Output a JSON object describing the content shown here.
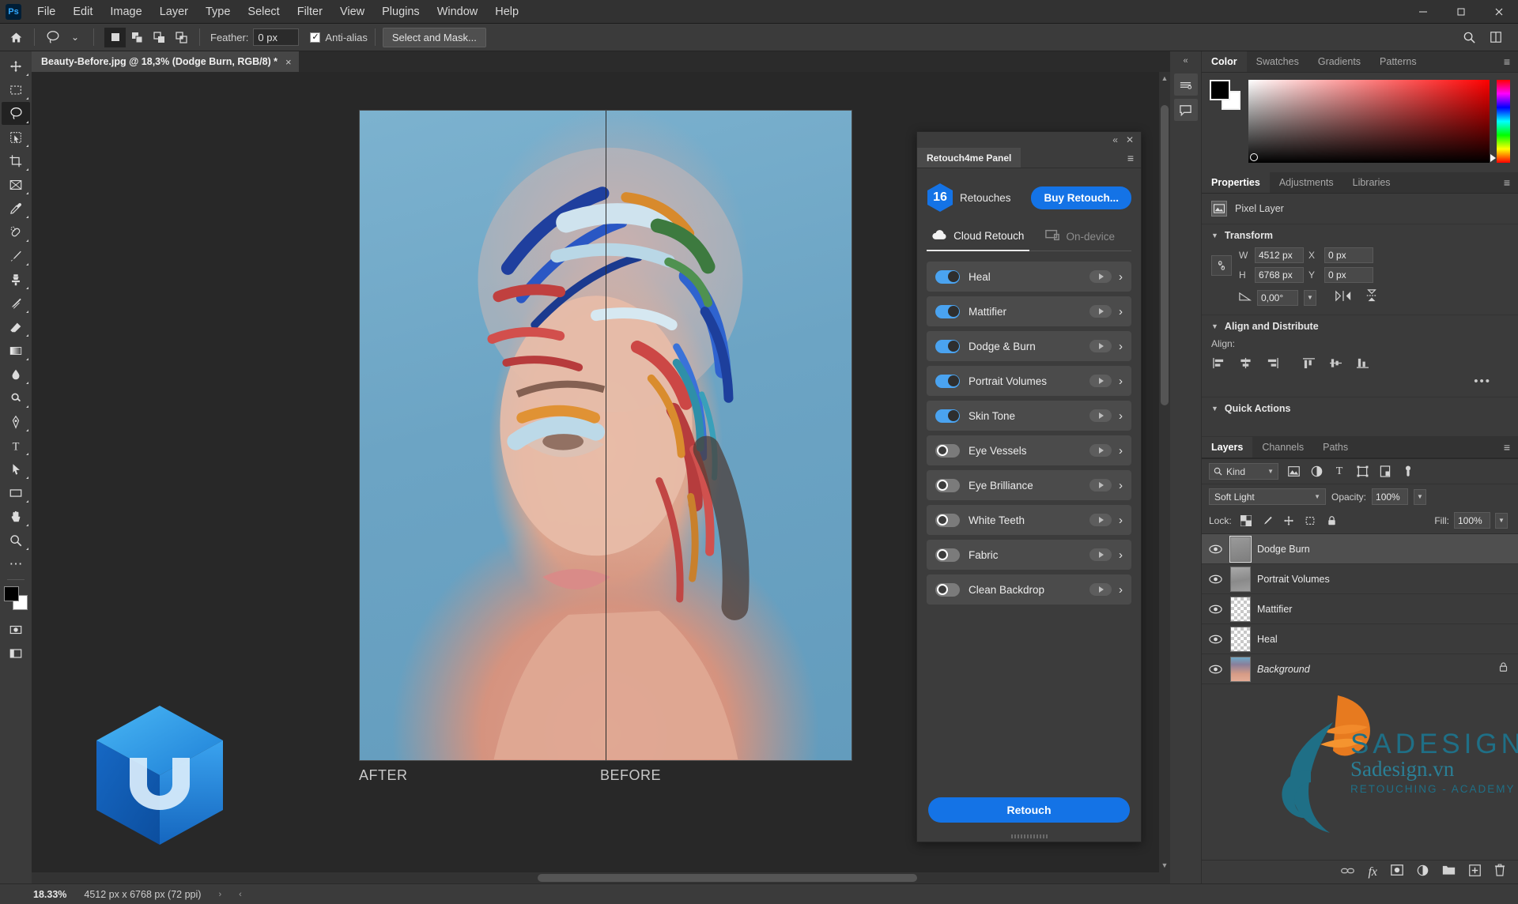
{
  "app": {
    "logo_text": "Ps",
    "menus": [
      "File",
      "Edit",
      "Image",
      "Layer",
      "Type",
      "Select",
      "Filter",
      "View",
      "Plugins",
      "Window",
      "Help"
    ],
    "window_buttons": {
      "minimize": "─",
      "maximize": "❐",
      "close": "✕"
    }
  },
  "options_bar": {
    "home_icon": "home-icon",
    "tool_icon": "lasso-icon",
    "tool_caret": "⌄",
    "selection_modes": [
      "new-selection",
      "add-to-selection",
      "subtract-from-selection",
      "intersect-selection"
    ],
    "feather_label": "Feather:",
    "feather_value": "0 px",
    "antialias_label": "Anti-alias",
    "antialias_checked": true,
    "select_and_mask_label": "Select and Mask...",
    "search_icon": "search-icon",
    "arrange_icon": "arrange-documents-icon"
  },
  "document": {
    "tab_title": "Beauty-Before.jpg @ 18,3% (Dodge Burn, RGB/8) *",
    "tab_close": "×",
    "label_after": "AFTER",
    "label_before": "BEFORE"
  },
  "toolbar": {
    "tools": [
      {
        "name": "move-tool",
        "glyph": "✥",
        "active": false
      },
      {
        "name": "rectangular-marquee-tool",
        "glyph": "⬚",
        "active": false
      },
      {
        "name": "lasso-tool",
        "glyph": "⥁",
        "active": true
      },
      {
        "name": "object-selection-tool",
        "glyph": "⬚",
        "active": false
      },
      {
        "name": "crop-tool",
        "glyph": "⌗",
        "active": false
      },
      {
        "name": "frame-tool",
        "glyph": "⌧",
        "active": false
      },
      {
        "name": "eyedropper-tool",
        "glyph": "✒",
        "active": false
      },
      {
        "name": "spot-healing-brush-tool",
        "glyph": "✘",
        "active": false
      },
      {
        "name": "brush-tool",
        "glyph": "✎",
        "active": false
      },
      {
        "name": "clone-stamp-tool",
        "glyph": "⚑",
        "active": false
      },
      {
        "name": "history-brush-tool",
        "glyph": "✐",
        "active": false
      },
      {
        "name": "eraser-tool",
        "glyph": "◱",
        "active": false
      },
      {
        "name": "gradient-tool",
        "glyph": "■",
        "active": false
      },
      {
        "name": "blur-tool",
        "glyph": "●",
        "active": false
      },
      {
        "name": "dodge-tool",
        "glyph": "⚲",
        "active": false
      },
      {
        "name": "pen-tool",
        "glyph": "✒",
        "active": false
      },
      {
        "name": "type-tool",
        "glyph": "T",
        "active": false
      },
      {
        "name": "path-selection-tool",
        "glyph": "➤",
        "active": false
      },
      {
        "name": "rectangle-tool",
        "glyph": "▭",
        "active": false
      },
      {
        "name": "hand-tool",
        "glyph": "✋",
        "active": false
      },
      {
        "name": "zoom-tool",
        "glyph": "⌕",
        "active": false
      },
      {
        "name": "more-tools",
        "glyph": "⋯",
        "active": false
      },
      {
        "name": "edit-toolbar",
        "glyph": "□",
        "active": false
      }
    ],
    "quickmask_name": "quick-mask-mode",
    "screenmode_name": "screen-mode"
  },
  "retouch_panel": {
    "collapse_glyph": "«",
    "close_glyph": "✕",
    "tab_label": "Retouch4me Panel",
    "menu_glyph": "≡",
    "credits_count": "16",
    "credits_label": "Retouches",
    "buy_label": "Buy Retouch...",
    "modes": [
      {
        "label": "Cloud Retouch",
        "icon": "cloud-icon",
        "active": true
      },
      {
        "label": "On-device",
        "icon": "monitor-icon",
        "active": false
      }
    ],
    "tools": [
      {
        "label": "Heal",
        "enabled": true
      },
      {
        "label": "Mattifier",
        "enabled": true
      },
      {
        "label": "Dodge & Burn",
        "enabled": true
      },
      {
        "label": "Portrait Volumes",
        "enabled": true
      },
      {
        "label": "Skin Tone",
        "enabled": true
      },
      {
        "label": "Eye Vessels",
        "enabled": false
      },
      {
        "label": "Eye Brilliance",
        "enabled": false
      },
      {
        "label": "White Teeth",
        "enabled": false
      },
      {
        "label": "Fabric",
        "enabled": false
      },
      {
        "label": "Clean Backdrop",
        "enabled": false
      }
    ],
    "retouch_button": "Retouch",
    "accent_color": "#1473e6",
    "toggle_on_color": "#4aa3f0"
  },
  "right_dock": {
    "rail_collapse_glyph": "«",
    "rail_buttons": [
      "history-icon",
      "comments-icon"
    ],
    "color_panel": {
      "tabs": [
        "Color",
        "Swatches",
        "Gradients",
        "Patterns"
      ],
      "active_tab": "Color",
      "menu_glyph": "≡",
      "foreground": "#000000",
      "background": "#ffffff"
    },
    "properties_panel": {
      "tabs": [
        "Properties",
        "Adjustments",
        "Libraries"
      ],
      "active_tab": "Properties",
      "menu_glyph": "≡",
      "layer_type": "Pixel Layer",
      "transform": {
        "title": "Transform",
        "w_label": "W",
        "w_value": "4512 px",
        "h_label": "H",
        "h_value": "6768 px",
        "x_label": "X",
        "x_value": "0 px",
        "y_label": "Y",
        "y_value": "0 px",
        "angle_value": "0,00°"
      },
      "align": {
        "title": "Align and Distribute",
        "align_label": "Align:",
        "more_glyph": "•••"
      },
      "quick_actions": {
        "title": "Quick Actions"
      }
    },
    "layers_panel": {
      "tabs": [
        "Layers",
        "Channels",
        "Paths"
      ],
      "active_tab": "Layers",
      "menu_glyph": "≡",
      "filter_label": "Kind",
      "filter_icons": [
        "pixel-filter-icon",
        "adjustment-filter-icon",
        "type-filter-icon",
        "shape-filter-icon",
        "smartobject-filter-icon",
        "effects-filter-icon"
      ],
      "blend_mode": "Soft Light",
      "opacity_label": "Opacity:",
      "opacity_value": "100%",
      "lock_label": "Lock:",
      "lock_icons": [
        "lock-transparent-pixels-icon",
        "lock-image-pixels-icon",
        "lock-position-icon",
        "lock-artboard-icon",
        "lock-all-icon"
      ],
      "fill_label": "Fill:",
      "fill_value": "100%",
      "layers": [
        {
          "name": "Dodge Burn",
          "selected": true,
          "visible": true,
          "thumb": "grey",
          "locked": false
        },
        {
          "name": "Portrait Volumes",
          "selected": false,
          "visible": true,
          "thumb": "portrait",
          "locked": false
        },
        {
          "name": "Mattifier",
          "selected": false,
          "visible": true,
          "thumb": "checker",
          "locked": false
        },
        {
          "name": "Heal",
          "selected": false,
          "visible": true,
          "thumb": "checker",
          "locked": false
        },
        {
          "name": "Background",
          "selected": false,
          "visible": true,
          "thumb": "photo",
          "locked": true,
          "italic": true
        }
      ],
      "footer_icons": [
        "link-layers-icon",
        "layer-style-icon",
        "layer-mask-icon",
        "adjustment-layer-icon",
        "new-group-icon",
        "new-layer-icon",
        "delete-layer-icon"
      ],
      "fx_label": "fx"
    }
  },
  "status_bar": {
    "zoom": "18.33%",
    "doc_size": "4512 px x 6768 px (72 ppi)",
    "arrow_right": "›",
    "arrow_left": "‹"
  },
  "watermark": {
    "main": "SADESIGN",
    "sub": "Sadesign.vn",
    "sub2": "RETOUCHING - ACADEMY",
    "color": "#1f6f86"
  }
}
